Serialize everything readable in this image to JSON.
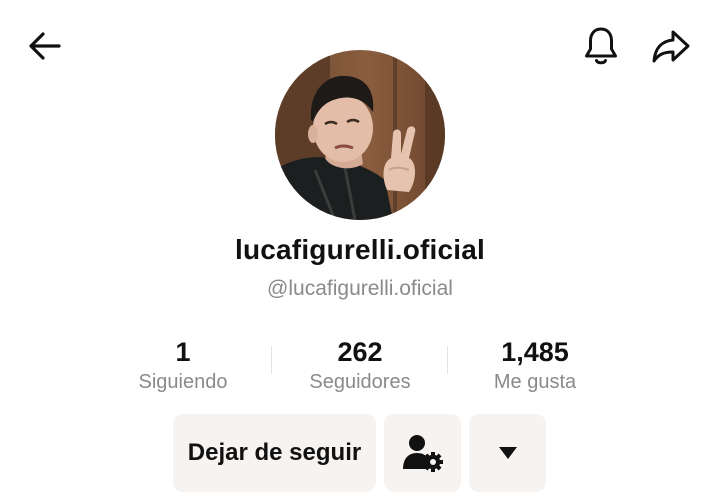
{
  "header": {
    "back_icon": "arrow-left-icon",
    "notification_icon": "bell-icon",
    "share_icon": "share-icon"
  },
  "profile": {
    "display_name": "lucafigurelli.oficial",
    "handle": "@lucafigurelli.oficial",
    "avatar_icon": "profile-photo"
  },
  "stats": [
    {
      "value": "1",
      "label": "Siguiendo"
    },
    {
      "value": "262",
      "label": "Seguidores"
    },
    {
      "value": "1,485",
      "label": "Me gusta"
    }
  ],
  "actions": {
    "unfollow_label": "Dejar de seguir",
    "suggest_icon": "person-gear-icon",
    "more_icon": "caret-down-icon"
  },
  "colors": {
    "button_bg": "#f6f3f1",
    "secondary_text": "#8a8a8a",
    "primary_text": "#111111"
  }
}
